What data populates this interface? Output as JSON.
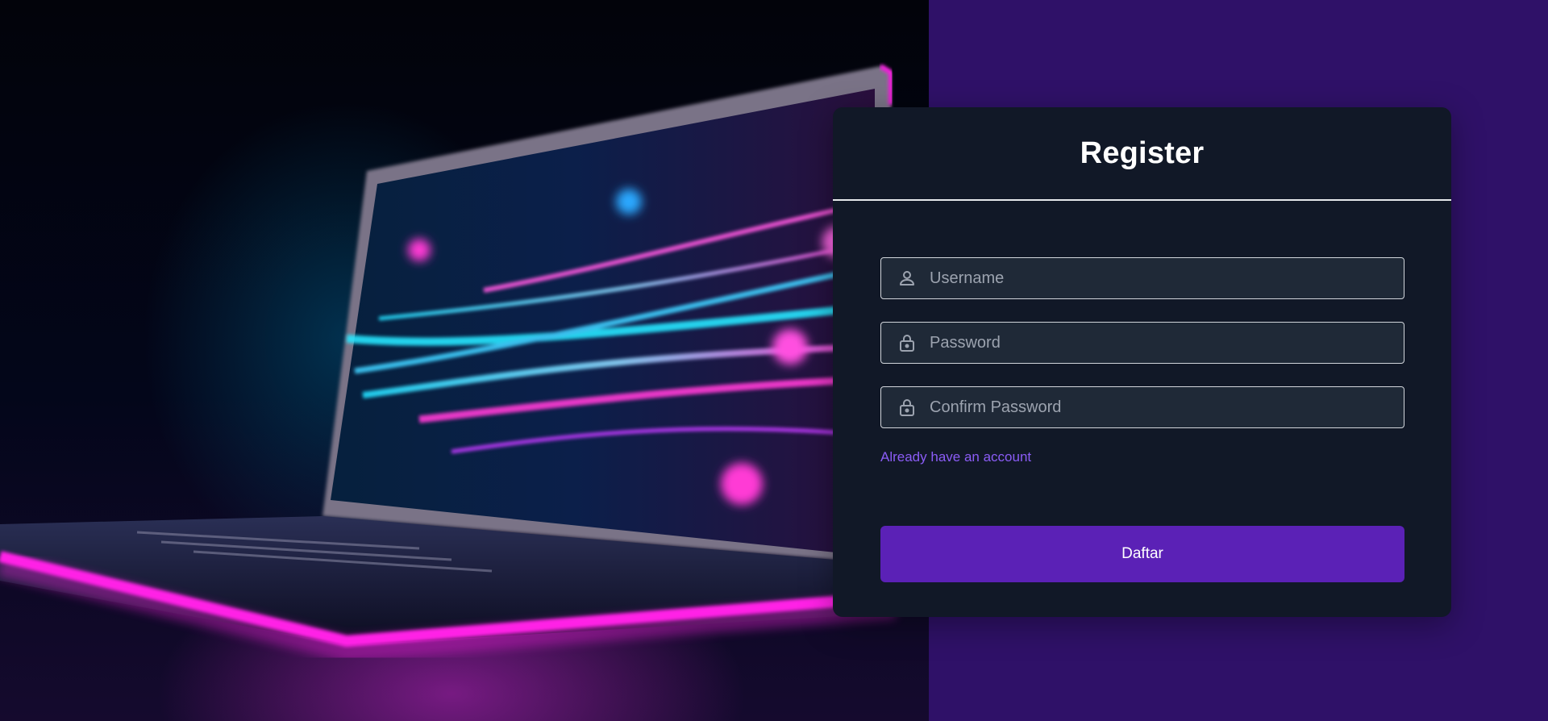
{
  "form": {
    "title": "Register",
    "username_placeholder": "Username",
    "password_placeholder": "Password",
    "confirm_placeholder": "Confirm Password",
    "login_link": "Already have an account",
    "submit_label": "Daftar"
  },
  "icons": {
    "username": "user-icon",
    "password": "lock-icon",
    "confirm": "lock-icon"
  },
  "colors": {
    "background": "#2f1168",
    "card": "#111827",
    "input": "#1f2937",
    "accent": "#5b21b6",
    "link": "#8b5cf6"
  }
}
